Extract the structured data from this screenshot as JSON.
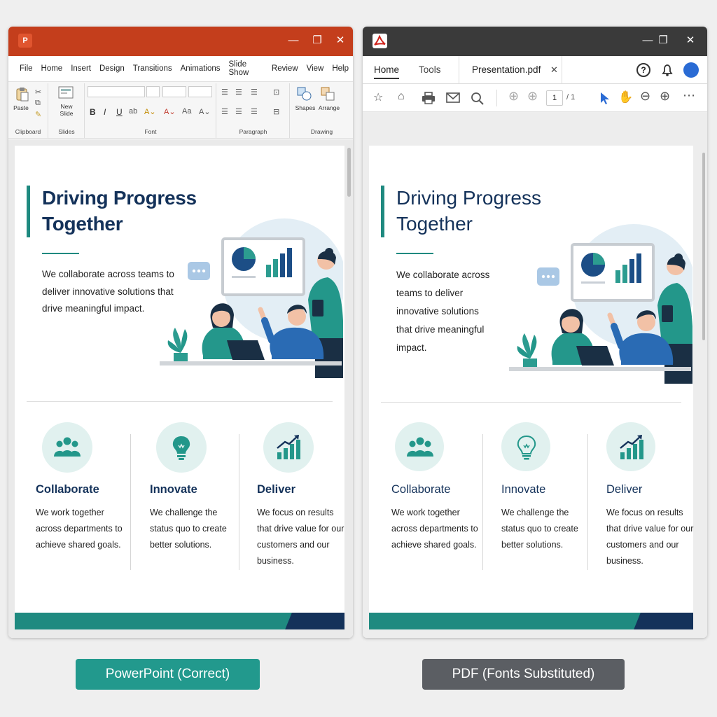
{
  "powerpoint": {
    "menu": [
      "File",
      "Home",
      "Insert",
      "Design",
      "Transitions",
      "Animations",
      "Slide Show",
      "Review",
      "View",
      "Help"
    ],
    "ribbon": {
      "paste": "Paste",
      "new_slide": "New\nSlide",
      "shapes": "Shapes",
      "arrange": "Arrange",
      "groups": [
        "Clipboard",
        "Slides",
        "Font",
        "Paragraph",
        "Drawing"
      ],
      "font_buttons": [
        "B",
        "I",
        "U"
      ]
    }
  },
  "pdf": {
    "tabs": {
      "home": "Home",
      "tools": "Tools",
      "document": "Presentation.pdf"
    },
    "page_current": "1",
    "page_total": "/ 1"
  },
  "slide": {
    "title_line1": "Driving Progress",
    "title_line2": "Together",
    "intro": "We collaborate across teams to deliver innovative solutions that drive meaningful impact.",
    "columns": [
      {
        "title": "Collaborate",
        "text": "We work together across departments to achieve shared goals.",
        "icon": "people-group-icon"
      },
      {
        "title": "Innovate",
        "text": "We challenge the status quo to create better solutions.",
        "icon": "lightbulb-icon"
      },
      {
        "title": "Deliver",
        "text": "We focus on results that drive value for our customers and our business.",
        "icon": "growth-chart-icon"
      }
    ]
  },
  "captions": {
    "left": "PowerPoint (Correct)",
    "right": "PDF (Fonts Substituted)"
  },
  "colors": {
    "teal": "#1f8a80",
    "navy": "#14325a",
    "powerpoint_red": "#c43e1c",
    "pdf_gray": "#3a3a3a"
  }
}
